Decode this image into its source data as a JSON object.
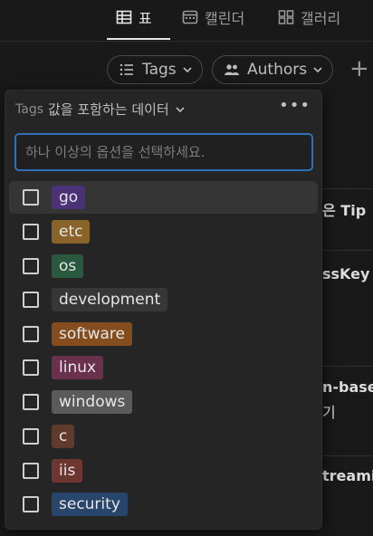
{
  "tabs": [
    {
      "label": "표",
      "icon": "table-icon"
    },
    {
      "label": "캘린더",
      "icon": "calendar-icon"
    },
    {
      "label": "갤러리",
      "icon": "gallery-icon"
    }
  ],
  "filters": [
    {
      "label": "Tags",
      "icon": "list-icon"
    },
    {
      "label": "Authors",
      "icon": "people-icon"
    }
  ],
  "add_filter_label": "+",
  "background_text": [
    "은 Tip",
    "ssKey 시",
    "n-based",
    "기",
    "treamin"
  ],
  "panel": {
    "property": "Tags",
    "condition": "값을 포함하는 데이터",
    "more_label": "•••",
    "search_placeholder": "하나 이상의 옵션을 선택하세요.",
    "options": [
      {
        "label": "go",
        "color": "#4b3278"
      },
      {
        "label": "etc",
        "color": "#89632a"
      },
      {
        "label": "os",
        "color": "#2b593f"
      },
      {
        "label": "development",
        "color": "#373737"
      },
      {
        "label": "software",
        "color": "#854c1d"
      },
      {
        "label": "linux",
        "color": "#69314c"
      },
      {
        "label": "windows",
        "color": "#5a5a5a"
      },
      {
        "label": "c",
        "color": "#603b2c"
      },
      {
        "label": "iis",
        "color": "#6e3630"
      },
      {
        "label": "security",
        "color": "#28456c"
      }
    ]
  }
}
